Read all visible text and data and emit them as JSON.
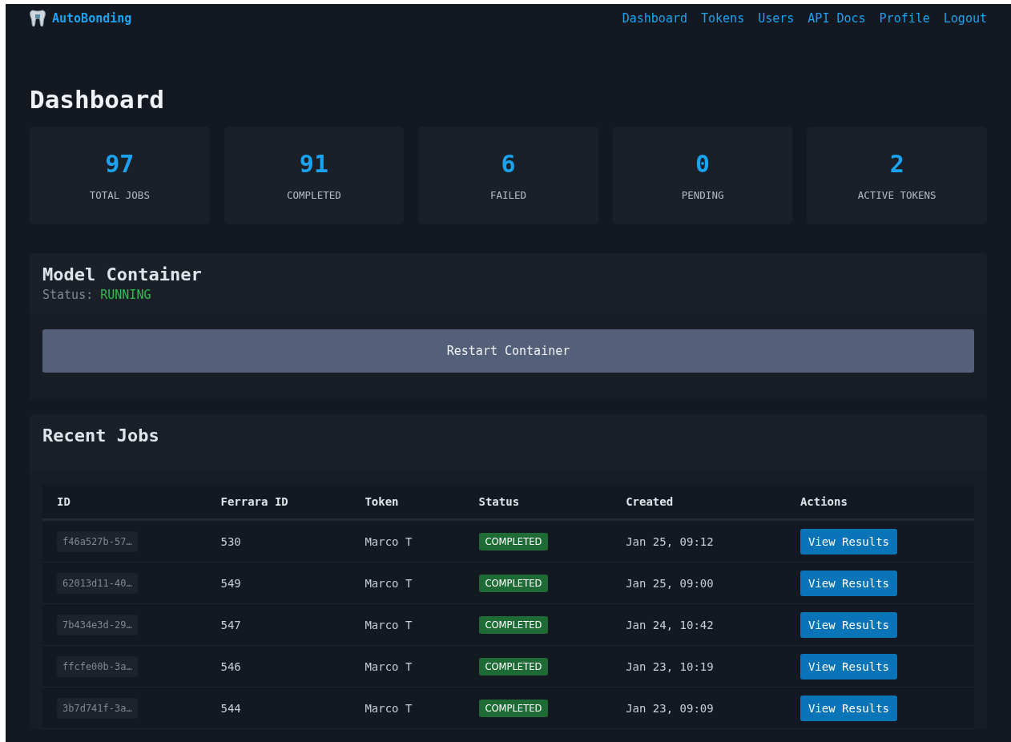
{
  "brand": "AutoBonding",
  "nav": [
    {
      "label": "Dashboard"
    },
    {
      "label": "Tokens"
    },
    {
      "label": "Users"
    },
    {
      "label": "API Docs"
    },
    {
      "label": "Profile"
    },
    {
      "label": "Logout"
    }
  ],
  "page_title": "Dashboard",
  "stats": [
    {
      "value": "97",
      "label": "TOTAL JOBS"
    },
    {
      "value": "91",
      "label": "COMPLETED"
    },
    {
      "value": "6",
      "label": "FAILED"
    },
    {
      "value": "0",
      "label": "PENDING"
    },
    {
      "value": "2",
      "label": "ACTIVE TOKENS"
    }
  ],
  "container": {
    "title": "Model Container",
    "status_label": "Status:",
    "status": "RUNNING",
    "button": "Restart Container"
  },
  "jobs": {
    "title": "Recent Jobs",
    "columns": [
      "ID",
      "Ferrara ID",
      "Token",
      "Status",
      "Created",
      "Actions"
    ],
    "rows": [
      {
        "id": "f46a527b-57…",
        "ferrara_id": "530",
        "token": "Marco T",
        "status": "COMPLETED",
        "created": "Jan 25, 09:12",
        "action": "View Results"
      },
      {
        "id": "62013d11-40…",
        "ferrara_id": "549",
        "token": "Marco T",
        "status": "COMPLETED",
        "created": "Jan 25, 09:00",
        "action": "View Results"
      },
      {
        "id": "7b434e3d-29…",
        "ferrara_id": "547",
        "token": "Marco T",
        "status": "COMPLETED",
        "created": "Jan 24, 10:42",
        "action": "View Results"
      },
      {
        "id": "ffcfe00b-3a…",
        "ferrara_id": "546",
        "token": "Marco T",
        "status": "COMPLETED",
        "created": "Jan 23, 10:19",
        "action": "View Results"
      },
      {
        "id": "3b7d741f-3a…",
        "ferrara_id": "544",
        "token": "Marco T",
        "status": "COMPLETED",
        "created": "Jan 23, 09:09",
        "action": "View Results"
      }
    ]
  }
}
